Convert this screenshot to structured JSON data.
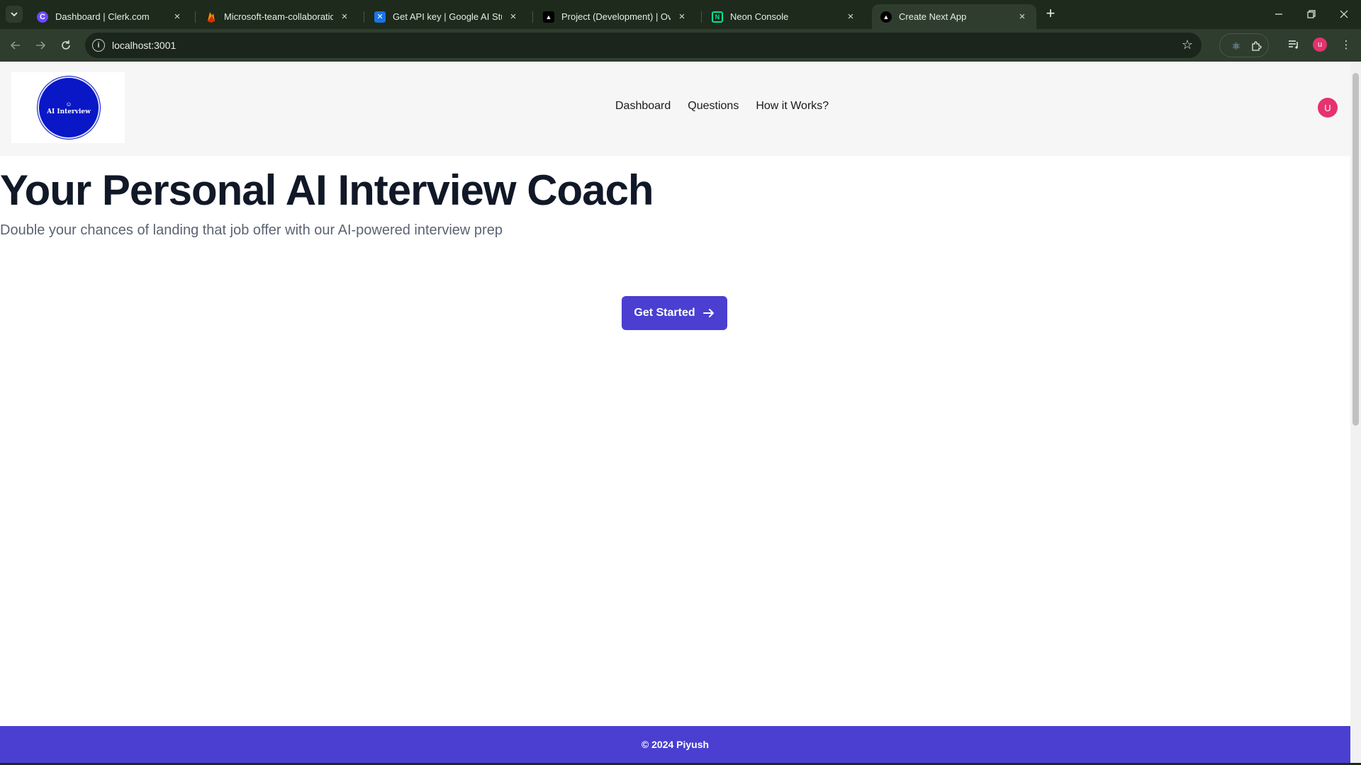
{
  "browser": {
    "tabs": [
      {
        "title": "Dashboard | Clerk.com",
        "icon": "clerk-icon"
      },
      {
        "title": "Microsoft-team-collaboration -",
        "icon": "firebase-icon"
      },
      {
        "title": "Get API key | Google AI Studio",
        "icon": "google-ai-studio-icon"
      },
      {
        "title": "Project (Development) | Overvie",
        "icon": "project-icon"
      },
      {
        "title": "Neon Console",
        "icon": "neon-icon"
      },
      {
        "title": "Create Next App",
        "icon": "nextjs-icon"
      }
    ],
    "active_tab": 5,
    "url": "localhost:3001",
    "profile_initial": "u"
  },
  "site": {
    "logo_text": "AI Interview",
    "nav": [
      "Dashboard",
      "Questions",
      "How it Works?"
    ],
    "user_initial": "U"
  },
  "hero": {
    "title": "Your Personal AI Interview Coach",
    "subtitle": "Double your chances of landing that job offer with our AI-powered interview prep",
    "cta_label": "Get Started"
  },
  "footer": {
    "text": "© 2024 Piyush"
  },
  "colors": {
    "accent": "#4a3fd1",
    "logo_blue": "#0a17c7",
    "avatar_pink": "#e5336f",
    "chrome_dark": "#1d2a1c"
  }
}
